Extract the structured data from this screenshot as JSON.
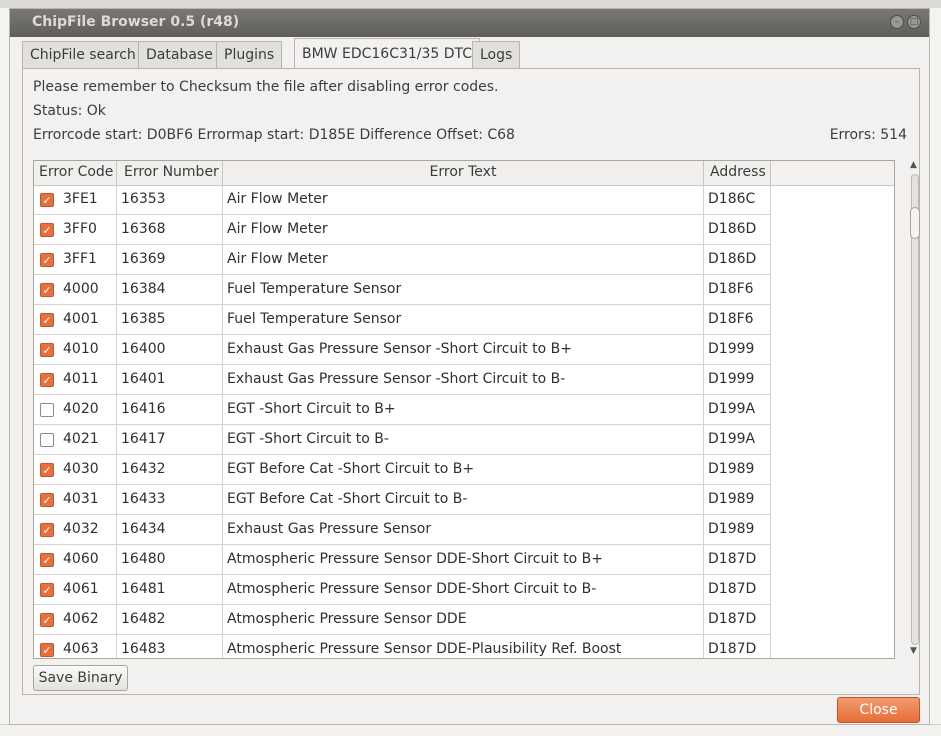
{
  "window": {
    "title": "ChipFile Browser 0.5 (r48)"
  },
  "tabs": [
    "ChipFile search",
    "Database",
    "Plugins",
    "BMW EDC16C31/35 DTC",
    "Logs"
  ],
  "active_tab": 3,
  "info": {
    "reminder": "Please remember to Checksum the file after disabling error codes.",
    "status": "Status:  Ok",
    "offsets": "Errorcode start:  D0BF6  Errormap start:  D185E  Difference Offset:  C68",
    "errors": "Errors:  514"
  },
  "table": {
    "headers": [
      "Error Code",
      "Error Number",
      "Error Text",
      "Address"
    ],
    "rows": [
      {
        "checked": true,
        "code": "3FE1",
        "number": "16353",
        "text": "Air Flow Meter",
        "address": "D186C"
      },
      {
        "checked": true,
        "code": "3FF0",
        "number": "16368",
        "text": "Air Flow Meter",
        "address": "D186D"
      },
      {
        "checked": true,
        "code": "3FF1",
        "number": "16369",
        "text": "Air Flow Meter",
        "address": "D186D"
      },
      {
        "checked": true,
        "code": "4000",
        "number": "16384",
        "text": "Fuel Temperature Sensor",
        "address": "D18F6"
      },
      {
        "checked": true,
        "code": "4001",
        "number": "16385",
        "text": "Fuel Temperature Sensor",
        "address": "D18F6"
      },
      {
        "checked": true,
        "code": "4010",
        "number": "16400",
        "text": "Exhaust Gas Pressure Sensor -Short Circuit to B+",
        "address": "D1999"
      },
      {
        "checked": true,
        "code": "4011",
        "number": "16401",
        "text": "Exhaust Gas Pressure Sensor -Short Circuit to B-",
        "address": "D1999"
      },
      {
        "checked": false,
        "code": "4020",
        "number": "16416",
        "text": "EGT -Short Circuit to B+",
        "address": "D199A"
      },
      {
        "checked": false,
        "code": "4021",
        "number": "16417",
        "text": "EGT -Short Circuit to B-",
        "address": "D199A"
      },
      {
        "checked": true,
        "code": "4030",
        "number": "16432",
        "text": "EGT Before Cat -Short Circuit to B+",
        "address": "D1989"
      },
      {
        "checked": true,
        "code": "4031",
        "number": "16433",
        "text": "EGT Before Cat -Short Circuit to B-",
        "address": "D1989"
      },
      {
        "checked": true,
        "code": "4032",
        "number": "16434",
        "text": "Exhaust Gas Pressure Sensor",
        "address": "D1989"
      },
      {
        "checked": true,
        "code": "4060",
        "number": "16480",
        "text": "Atmospheric Pressure Sensor DDE-Short Circuit to B+",
        "address": "D187D"
      },
      {
        "checked": true,
        "code": "4061",
        "number": "16481",
        "text": "Atmospheric Pressure Sensor DDE-Short Circuit to B-",
        "address": "D187D"
      },
      {
        "checked": true,
        "code": "4062",
        "number": "16482",
        "text": "Atmospheric Pressure Sensor DDE",
        "address": "D187D"
      },
      {
        "checked": true,
        "code": "4063",
        "number": "16483",
        "text": "Atmospheric Pressure Sensor DDE-Plausibility Ref. Boost",
        "address": "D187D"
      }
    ]
  },
  "buttons": {
    "save": "Save Binary",
    "close": "Close"
  },
  "colors": {
    "checkbox_on": "#e5713f",
    "close_button": "#e66d38",
    "titlebar": "#5f5e5a"
  }
}
